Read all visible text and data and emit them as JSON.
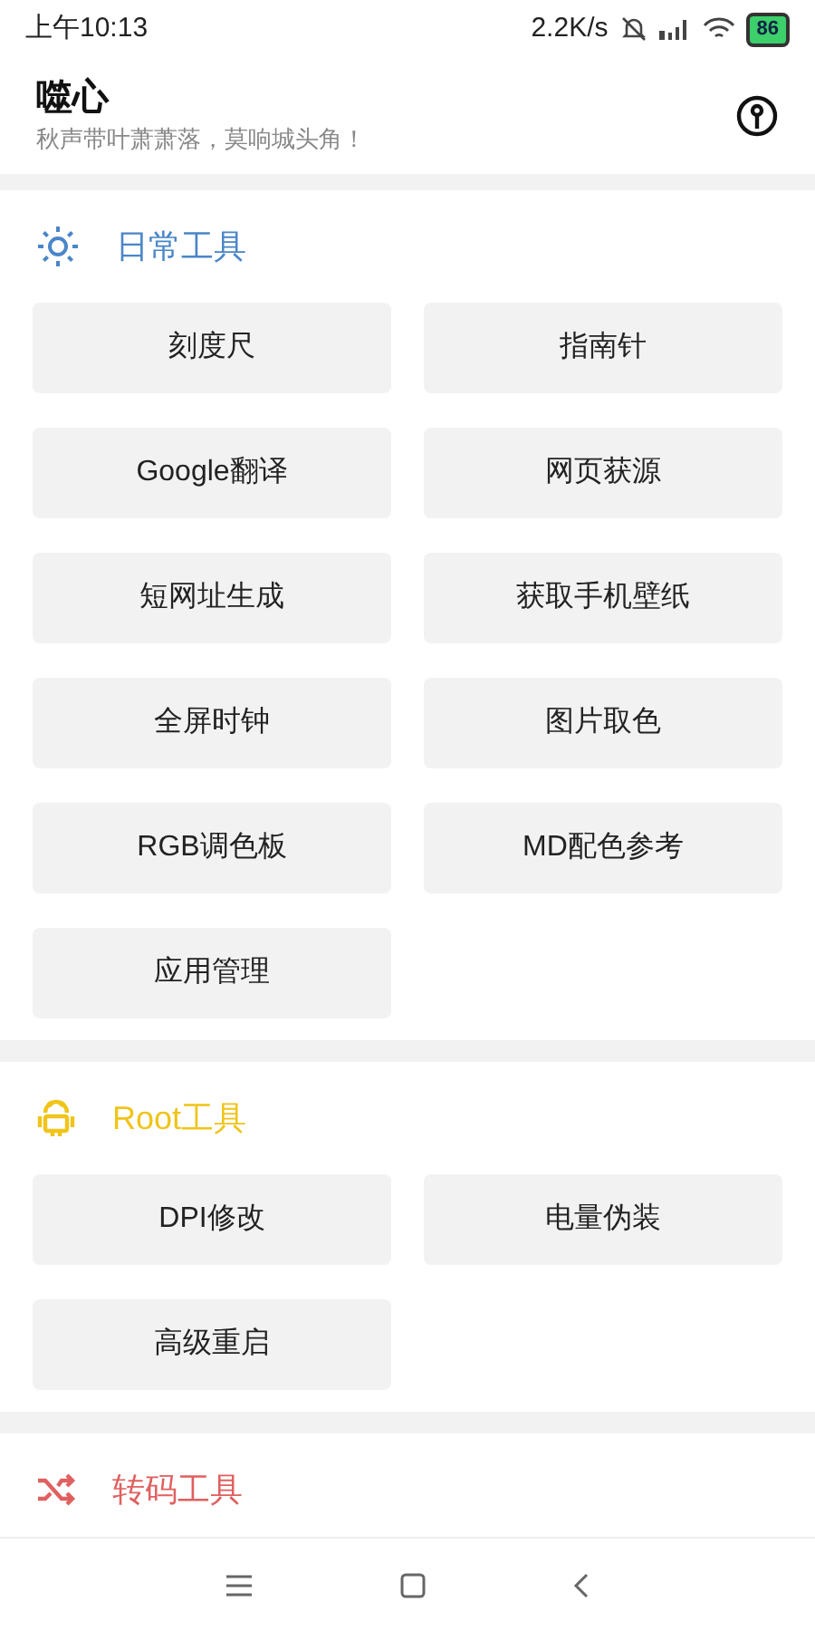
{
  "status_bar": {
    "time": "上午10:13",
    "net_speed": "2.2K/s",
    "battery": "86"
  },
  "header": {
    "title": "噬心",
    "subtitle": "秋声带叶萧萧落，莫响城头角！"
  },
  "sections": [
    {
      "title": "日常工具",
      "kind": "sun",
      "color": "#4a86c8",
      "buttons": [
        "刻度尺",
        "指南针",
        "Google翻译",
        "网页获源",
        "短网址生成",
        "获取手机壁纸",
        "全屏时钟",
        "图片取色",
        "RGB调色板",
        "MD配色参考",
        "应用管理"
      ]
    },
    {
      "title": "Root工具",
      "kind": "android",
      "color": "#f0c419",
      "buttons": [
        "DPI修改",
        "电量伪装",
        "高级重启"
      ]
    },
    {
      "title": "转码工具",
      "kind": "shuffle",
      "color": "#e06060"
    }
  ]
}
